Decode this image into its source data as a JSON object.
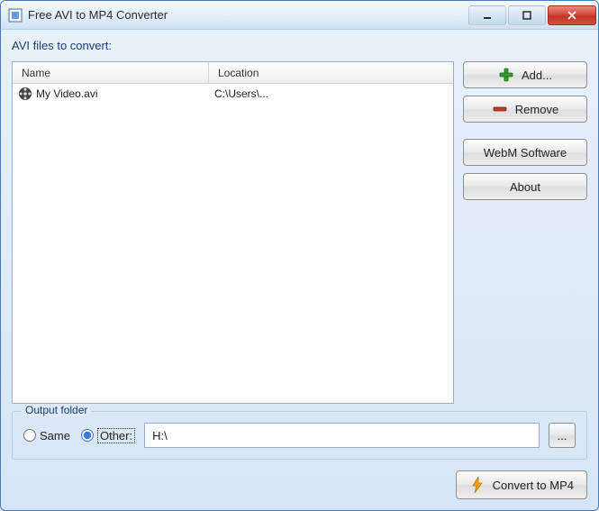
{
  "window": {
    "title": "Free AVI to MP4 Converter"
  },
  "labels": {
    "files_to_convert": "AVI files to convert:",
    "output_folder": "Output folder"
  },
  "columns": {
    "name": "Name",
    "location": "Location"
  },
  "files": [
    {
      "name": "My Video.avi",
      "location": "C:\\Users\\..."
    }
  ],
  "buttons": {
    "add": "Add...",
    "remove": "Remove",
    "webm": "WebM Software",
    "about": "About",
    "convert": "Convert to MP4",
    "browse": "..."
  },
  "output": {
    "same_label": "Same",
    "other_label": "Other:",
    "selected": "other",
    "path": "H:\\"
  },
  "icons": {
    "app": "app-window-icon",
    "file": "film-reel-icon",
    "add": "plus-icon",
    "remove": "minus-icon",
    "convert": "lightning-icon"
  },
  "colors": {
    "frame": "#d6e5f5",
    "accent_text": "#1a3e6e",
    "close_red": "#c23424",
    "add_green": "#33a02c",
    "remove_red": "#c0392b",
    "lightning": "#f1a20b"
  }
}
